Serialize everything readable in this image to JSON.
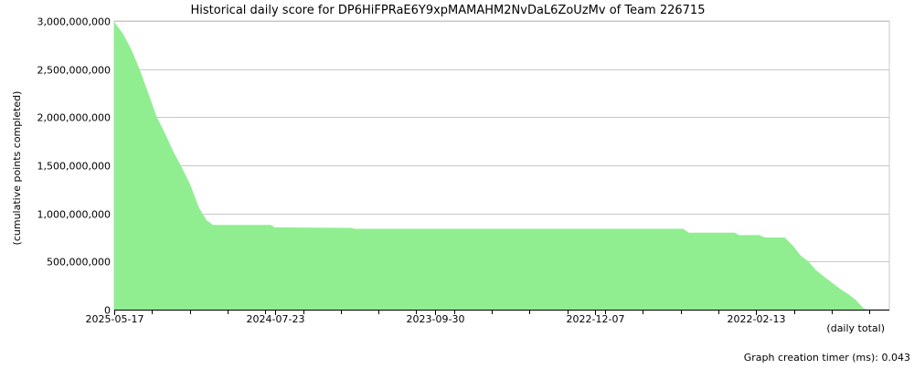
{
  "chart_data": {
    "type": "area",
    "title": "Historical daily score for DP6HiFPRaE6Y9xpMAMAHM2NvDaL6ZoUzMv of Team 226715",
    "xlabel": "(daily total)",
    "ylabel": "(cumulative points completed)",
    "ylim": [
      0,
      3000000000
    ],
    "y_ticks": [
      {
        "value": 0,
        "label": "0"
      },
      {
        "value": 500000000,
        "label": "500,000,000"
      },
      {
        "value": 1000000000,
        "label": "1,000,000,000"
      },
      {
        "value": 1500000000,
        "label": "1,500,000,000"
      },
      {
        "value": 2000000000,
        "label": "2,000,000,000"
      },
      {
        "value": 2500000000,
        "label": "2,500,000,000"
      },
      {
        "value": 3000000000,
        "label": "3,000,000,000"
      }
    ],
    "x_range": [
      "2025-05-17",
      "2021-06-10"
    ],
    "x_ticks": [
      {
        "date": "2025-05-17",
        "label": "2025-05-17"
      },
      {
        "date": "2024-07-23",
        "label": "2024-07-23"
      },
      {
        "date": "2023-09-30",
        "label": "2023-09-30"
      },
      {
        "date": "2022-12-07",
        "label": "2022-12-07"
      },
      {
        "date": "2022-02-13",
        "label": "2022-02-13"
      }
    ],
    "minor_tick_step_days": 70,
    "grid": true,
    "fill_color": "#90ee90",
    "points": [
      {
        "x": "2025-05-17",
        "y": 2990000000
      },
      {
        "x": "2025-05-01",
        "y": 2870000000
      },
      {
        "x": "2025-04-15",
        "y": 2700000000
      },
      {
        "x": "2025-03-31",
        "y": 2500000000
      },
      {
        "x": "2025-03-15",
        "y": 2250000000
      },
      {
        "x": "2025-02-27",
        "y": 2000000000
      },
      {
        "x": "2025-02-11",
        "y": 1820000000
      },
      {
        "x": "2025-01-28",
        "y": 1650000000
      },
      {
        "x": "2025-01-12",
        "y": 1480000000
      },
      {
        "x": "2024-12-27",
        "y": 1300000000
      },
      {
        "x": "2024-12-11",
        "y": 1060000000
      },
      {
        "x": "2024-11-27",
        "y": 930000000
      },
      {
        "x": "2024-11-15",
        "y": 880000000
      },
      {
        "x": "2024-07-30",
        "y": 880000000
      },
      {
        "x": "2024-07-24",
        "y": 855000000
      },
      {
        "x": "2024-03-03",
        "y": 850000000
      },
      {
        "x": "2024-02-27",
        "y": 840000000
      },
      {
        "x": "2022-06-27",
        "y": 840000000
      },
      {
        "x": "2022-06-17",
        "y": 800000000
      },
      {
        "x": "2022-03-23",
        "y": 800000000
      },
      {
        "x": "2022-03-16",
        "y": 775000000
      },
      {
        "x": "2022-02-06",
        "y": 775000000
      },
      {
        "x": "2022-01-27",
        "y": 750000000
      },
      {
        "x": "2021-12-21",
        "y": 750000000
      },
      {
        "x": "2021-12-05",
        "y": 660000000
      },
      {
        "x": "2021-11-21",
        "y": 560000000
      },
      {
        "x": "2021-11-07",
        "y": 500000000
      },
      {
        "x": "2021-10-24",
        "y": 410000000
      },
      {
        "x": "2021-10-08",
        "y": 340000000
      },
      {
        "x": "2021-09-24",
        "y": 280000000
      },
      {
        "x": "2021-09-08",
        "y": 210000000
      },
      {
        "x": "2021-08-25",
        "y": 160000000
      },
      {
        "x": "2021-08-11",
        "y": 100000000
      },
      {
        "x": "2021-07-29",
        "y": 20000000
      },
      {
        "x": "2021-07-21",
        "y": 0
      }
    ]
  },
  "footer": {
    "timer_label": "Graph creation timer (ms): 0.043"
  }
}
